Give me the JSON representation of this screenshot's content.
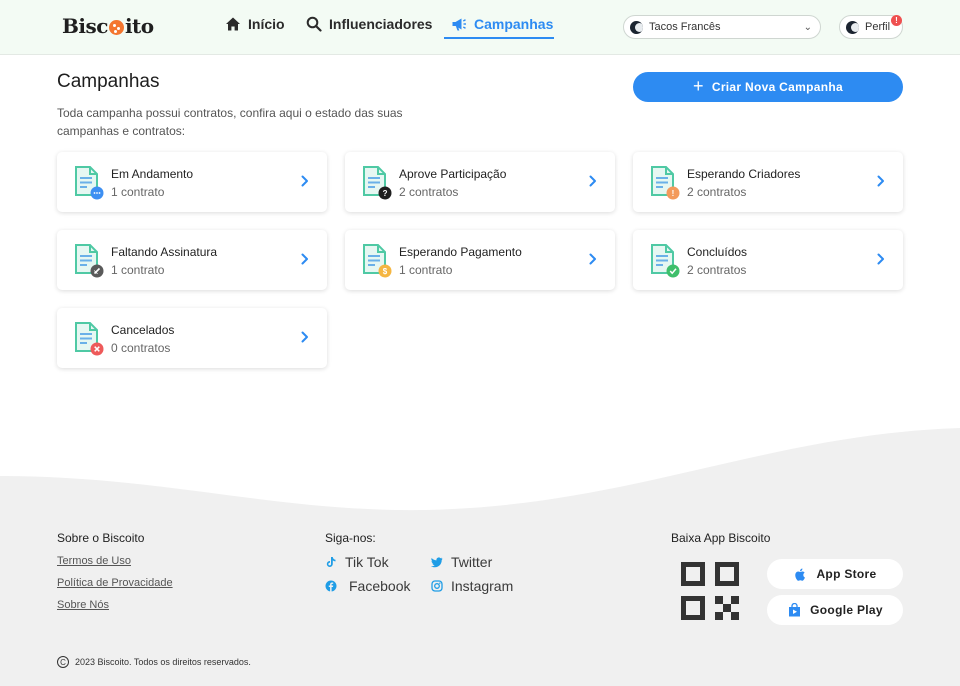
{
  "header": {
    "logo": {
      "before": "Bisc",
      "after": "ito"
    },
    "nav": [
      {
        "label": "Início",
        "icon": "home-icon"
      },
      {
        "label": "Influenciadores",
        "icon": "search-icon"
      },
      {
        "label": "Campanhas",
        "icon": "megaphone-icon",
        "active": true
      }
    ],
    "account": "Tacos Francês",
    "profile": "Perfil",
    "notification_count": "!"
  },
  "main": {
    "title": "Campanhas",
    "description": "Toda campanha possui contratos, confira aqui o estado das suas campanhas e contratos:",
    "create_button": "Criar Nova Campanha",
    "cards": [
      {
        "title": "Em Andamento",
        "subtitle": "1 contrato",
        "badge": "more-icon",
        "badge_color": "#3d8ff2"
      },
      {
        "title": "Aprove Participação",
        "subtitle": "2 contratos",
        "badge": "question-icon",
        "badge_color": "#1f1f1f"
      },
      {
        "title": "Esperando Criadores",
        "subtitle": "2 contratos",
        "badge": "alert-icon",
        "badge_color": "#f39a5b"
      },
      {
        "title": "Faltando Assinatura",
        "subtitle": "1 contrato",
        "badge": "pen-icon",
        "badge_color": "#5a5a5a"
      },
      {
        "title": "Esperando Pagamento",
        "subtitle": "1 contrato",
        "badge": "dollar-icon",
        "badge_color": "#f5b642"
      },
      {
        "title": "Concluídos",
        "subtitle": "2 contratos",
        "badge": "check-icon",
        "badge_color": "#3fbf6b"
      },
      {
        "title": "Cancelados",
        "subtitle": "0 contratos",
        "badge": "close-icon",
        "badge_color": "#ee5a5a"
      }
    ]
  },
  "footer": {
    "about_title": "Sobre o Biscoito",
    "links": [
      "Termos de Uso",
      "Política de Provacidade",
      "Sobre Nós"
    ],
    "follow_title": "Siga-nos:",
    "social": [
      {
        "label": "Tik Tok",
        "icon": "tiktok-icon"
      },
      {
        "label": "Twitter",
        "icon": "twitter-icon"
      },
      {
        "label": "Facebook",
        "icon": "facebook-icon"
      },
      {
        "label": "Instagram",
        "icon": "instagram-icon"
      }
    ],
    "app_title": "Baixa App Biscoito",
    "app_store": "App Store",
    "google_play": "Google Play",
    "copyright": "2023 Biscoito. Todos os direitos reservados."
  },
  "colors": {
    "accent": "#2d8bf2",
    "header_bg": "#f3fbf4",
    "footer_bg": "#f0f0f0",
    "logo_cookie": "#f4762f"
  }
}
